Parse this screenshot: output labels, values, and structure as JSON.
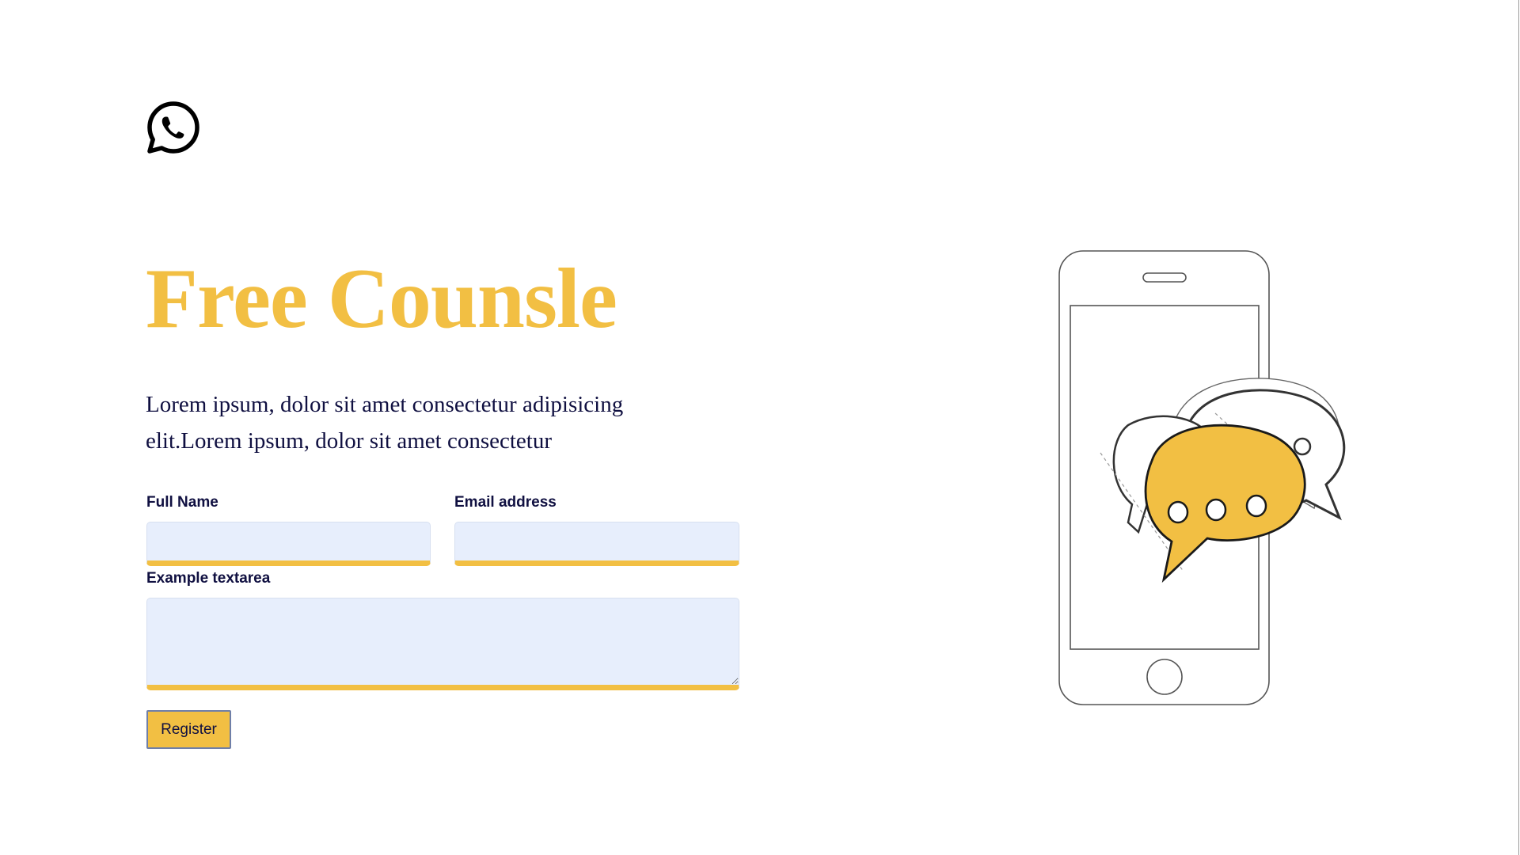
{
  "logo": {
    "icon": "whatsapp-icon"
  },
  "hero": {
    "title": "Free Counsle",
    "description": "Lorem ipsum, dolor sit amet consectetur adipisicing elit.Lorem ipsum, dolor sit amet consectetur"
  },
  "form": {
    "full_name": {
      "label": "Full Name",
      "value": "",
      "placeholder": ""
    },
    "email": {
      "label": "Email address",
      "value": "",
      "placeholder": ""
    },
    "message": {
      "label": "Example textarea",
      "value": "",
      "placeholder": ""
    },
    "submit_label": "Register"
  },
  "illustration": {
    "icon": "phone-chat-bubbles-icon"
  },
  "colors": {
    "accent": "#f2bf43",
    "text": "#101041",
    "input_bg": "#e7eefc"
  }
}
